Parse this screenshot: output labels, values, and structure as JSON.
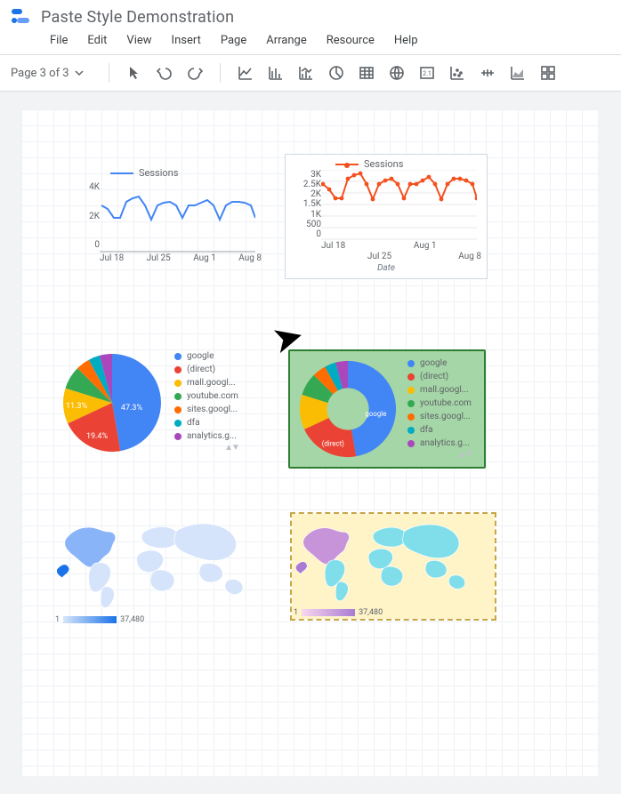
{
  "header": {
    "title": "Paste Style Demonstration",
    "menus": [
      "File",
      "Edit",
      "View",
      "Insert",
      "Page",
      "Arrange",
      "Resource",
      "Help"
    ]
  },
  "toolbar": {
    "page_label": "Page 3 of 3"
  },
  "chart_data": [
    {
      "id": "line-left",
      "type": "line",
      "series": [
        {
          "name": "Sessions",
          "values": [
            2500,
            2200,
            1900,
            1900,
            2800,
            3000,
            3100,
            2500,
            1800,
            2500,
            2700,
            2800,
            2500,
            1900,
            2500,
            2500,
            2700,
            2900,
            2500,
            1800,
            2500,
            2800,
            2800,
            2700,
            2500,
            1900
          ]
        }
      ],
      "x": [
        "Jul 18",
        "Jul 25",
        "Aug 1",
        "Aug 8"
      ],
      "ylim": [
        0,
        4000
      ],
      "yticks": [
        "4K",
        "2K",
        "0"
      ],
      "color": "#4285f4"
    },
    {
      "id": "line-right",
      "type": "line",
      "series": [
        {
          "name": "Sessions",
          "values": [
            2500,
            2200,
            1900,
            1900,
            2800,
            3000,
            3100,
            2500,
            1800,
            2500,
            2700,
            2800,
            2500,
            1900,
            2500,
            2500,
            2700,
            2900,
            2500,
            1800,
            2500,
            2800,
            2800,
            2700,
            2500,
            1900
          ]
        }
      ],
      "x": [
        "Jul 18",
        "Jul 25",
        "Aug 1",
        "Aug 8"
      ],
      "xlabel": "Date",
      "ylim": [
        0,
        3000
      ],
      "yticks": [
        "3K",
        "2.5K",
        "2K",
        "1.5K",
        "1K",
        "500",
        "0"
      ],
      "color": "#f4511e",
      "markers": true
    },
    {
      "id": "pie-left",
      "type": "pie",
      "data": [
        {
          "label": "google",
          "value": 47.3,
          "color": "#4285f4"
        },
        {
          "label": "(direct)",
          "value": 19.4,
          "color": "#ea4335"
        },
        {
          "label": "mall.googl...",
          "value": 11.3,
          "color": "#fbbc04"
        },
        {
          "label": "youtube.com",
          "value": 8,
          "color": "#34a853"
        },
        {
          "label": "sites.googl...",
          "value": 5,
          "color": "#ff6d01"
        },
        {
          "label": "dfa",
          "value": 4,
          "color": "#00acc1"
        },
        {
          "label": "analytics.g...",
          "value": 5,
          "color": "#ab47bc"
        }
      ],
      "labels_shown": [
        "47.3%",
        "19.4%",
        "11.3%"
      ]
    },
    {
      "id": "pie-right",
      "type": "pie",
      "donut": true,
      "data": [
        {
          "label": "google",
          "value": 47.3,
          "color": "#4285f4"
        },
        {
          "label": "(direct)",
          "value": 19.4,
          "color": "#ea4335"
        },
        {
          "label": "mall.googl...",
          "value": 11.3,
          "color": "#fbbc04"
        },
        {
          "label": "youtube.com",
          "value": 8,
          "color": "#34a853"
        },
        {
          "label": "sites.googl...",
          "value": 5,
          "color": "#ff6d01"
        },
        {
          "label": "dfa",
          "value": 4,
          "color": "#00acc1"
        },
        {
          "label": "analytics.g...",
          "value": 5,
          "color": "#ab47bc"
        }
      ],
      "labels_shown": [
        "google",
        "(direct)"
      ]
    },
    {
      "id": "map-left",
      "type": "map",
      "scale": {
        "min": 1,
        "max": 37480
      },
      "palette": "#cfe0fb → #1a73e8"
    },
    {
      "id": "map-right",
      "type": "map",
      "scale": {
        "min": 1,
        "max": 37480
      },
      "palette": "#f8d7f0 → #aa7bd4 over #80deea land"
    }
  ],
  "legend_items": [
    "google",
    "(direct)",
    "mall.googl...",
    "youtube.com",
    "sites.googl...",
    "dfa",
    "analytics.g..."
  ],
  "legend_colors": [
    "#4285f4",
    "#ea4335",
    "#fbbc04",
    "#34a853",
    "#ff6d01",
    "#00acc1",
    "#ab47bc"
  ],
  "map_scale": {
    "min": "1",
    "max": "37,480"
  }
}
